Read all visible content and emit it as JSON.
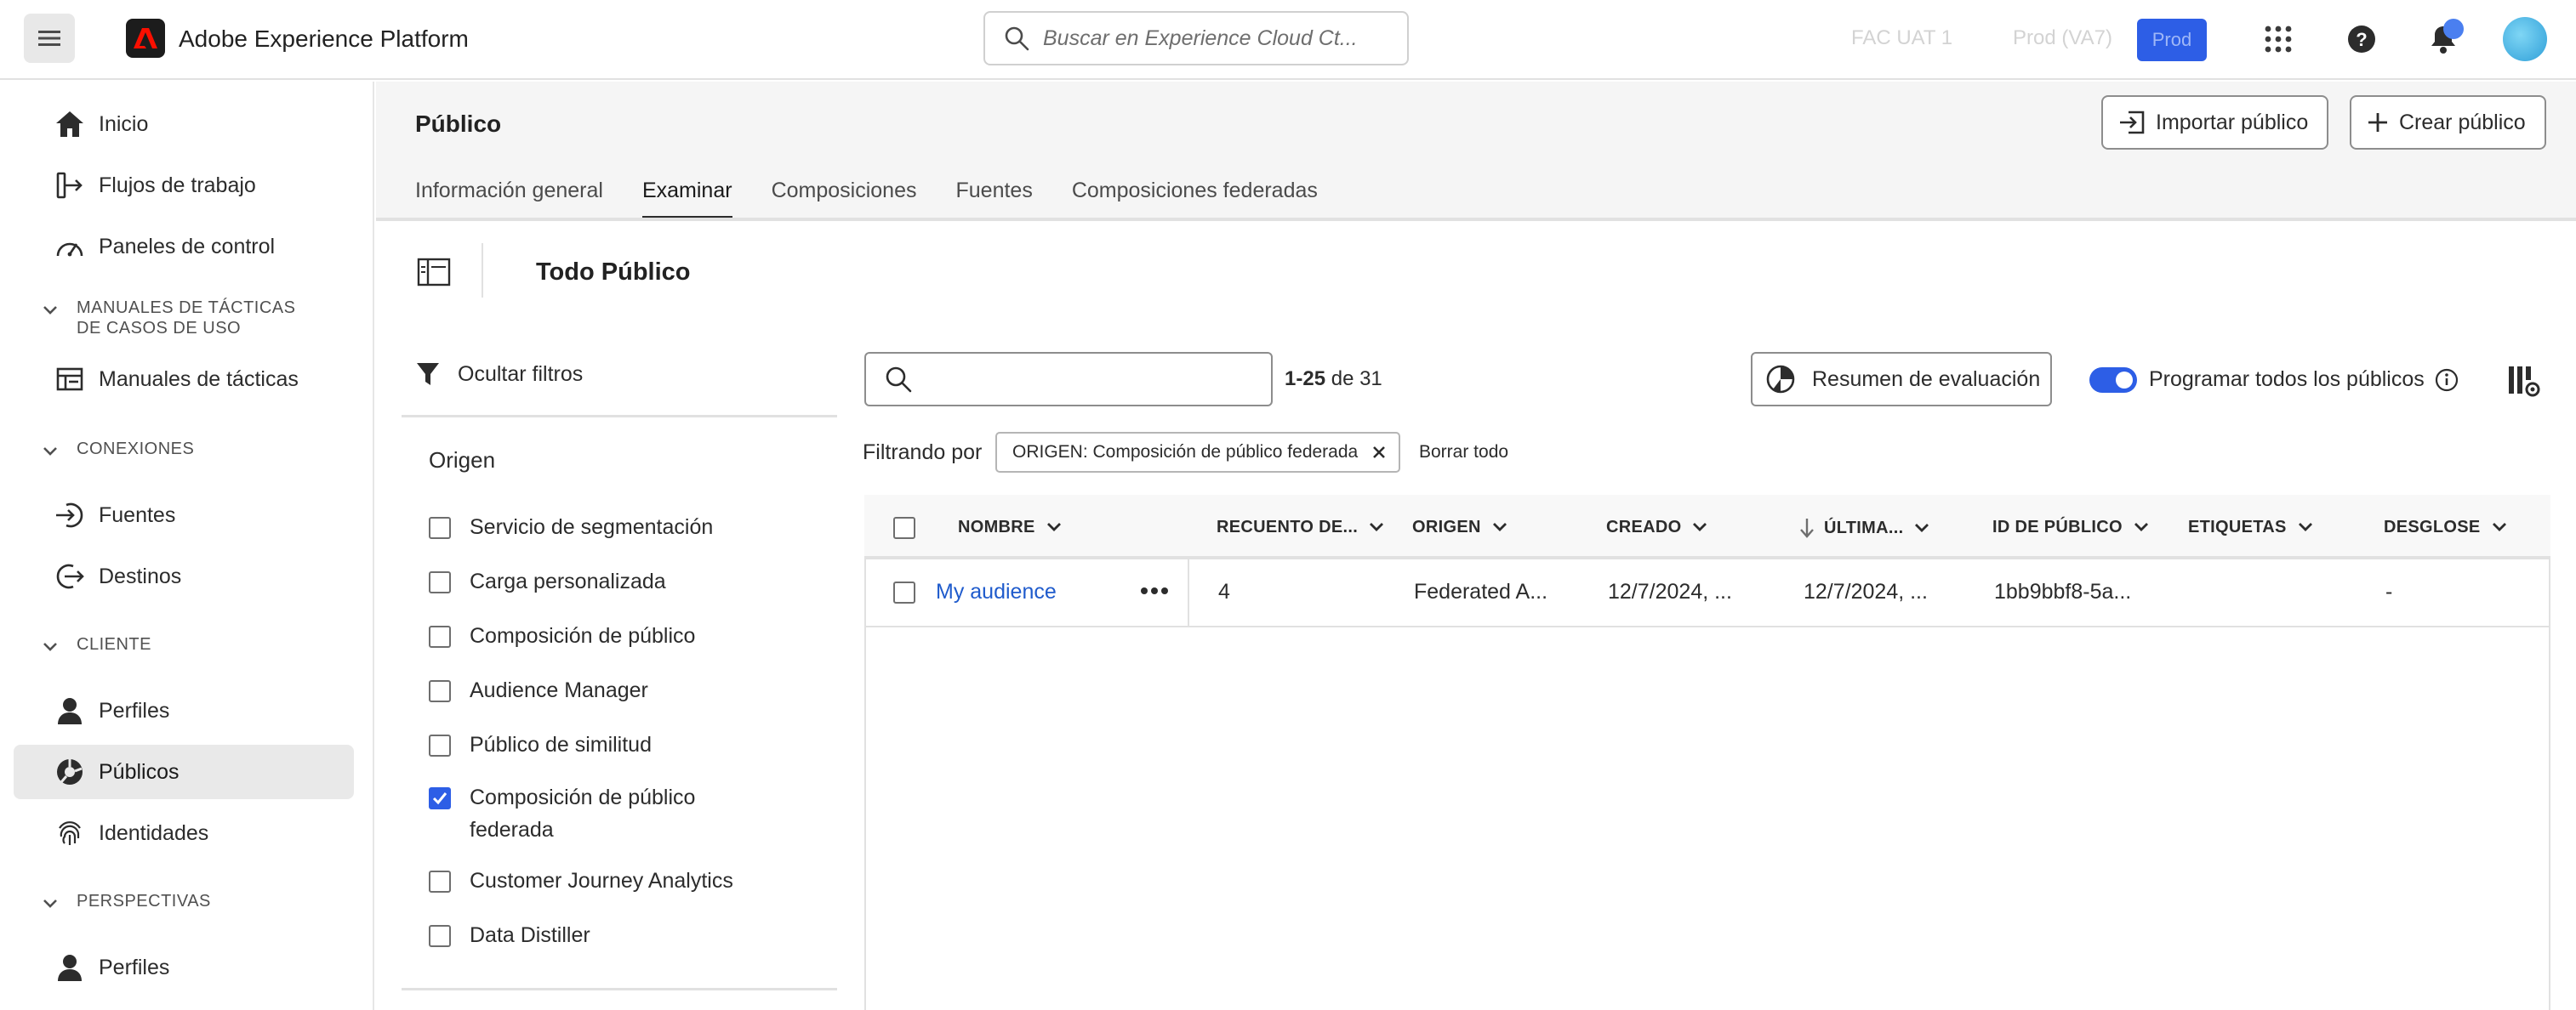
{
  "app": {
    "title": "Adobe Experience Platform"
  },
  "search": {
    "placeholder": "Buscar en Experience Cloud Ct..."
  },
  "orgs": {
    "org1": "FAC UAT 1",
    "org2": "Prod (VA7)",
    "sandbox": "Prod"
  },
  "colors": {
    "accent": "#2d5ee6",
    "link": "#1f5bcc"
  },
  "sidebar": {
    "items": [
      {
        "label": "Inicio",
        "icon": "home-icon"
      },
      {
        "label": "Flujos de trabajo",
        "icon": "workflow-icon"
      },
      {
        "label": "Paneles de control",
        "icon": "dashboard-icon"
      },
      {
        "label": "Manuales de tácticas",
        "icon": "playbook-icon"
      },
      {
        "label": "Fuentes",
        "icon": "source-icon"
      },
      {
        "label": "Destinos",
        "icon": "destination-icon"
      },
      {
        "label": "Perfiles",
        "icon": "user-icon"
      },
      {
        "label": "Públicos",
        "icon": "audience-icon"
      },
      {
        "label": "Identidades",
        "icon": "fingerprint-icon"
      },
      {
        "label": "Perfiles",
        "icon": "user-icon"
      }
    ],
    "sections": {
      "playbooks": "MANUALES DE TÁCTICAS DE CASOS DE USO",
      "connections": "CONEXIONES",
      "customer": "CLIENTE",
      "insights": "PERSPECTIVAS"
    }
  },
  "page": {
    "title": "Público",
    "import_label": "Importar público",
    "create_label": "Crear público",
    "tabs": [
      "Información general",
      "Examinar",
      "Composiciones",
      "Fuentes",
      "Composiciones federadas"
    ],
    "active_tab": "Examinar",
    "subtitle": "Todo Público"
  },
  "filters": {
    "hide_label": "Ocultar filtros",
    "origin_title": "Origen",
    "options": [
      {
        "label": "Servicio de segmentación",
        "checked": false
      },
      {
        "label": "Carga personalizada",
        "checked": false
      },
      {
        "label": "Composición de público",
        "checked": false
      },
      {
        "label": "Audience Manager",
        "checked": false
      },
      {
        "label": "Público de similitud",
        "checked": false
      },
      {
        "label": "Composición de público federada",
        "checked": true
      },
      {
        "label": "Customer Journey Analytics",
        "checked": false
      },
      {
        "label": "Data Distiller",
        "checked": false
      }
    ]
  },
  "table": {
    "range": "1-25",
    "range_of": "de 31",
    "summary_label": "Resumen de evaluación",
    "schedule_label": "Programar todos los públicos",
    "schedule_on": true,
    "filtering_label": "Filtrando por",
    "chip_label": "ORIGEN: Composición de público federada",
    "clear_all": "Borrar todo",
    "columns": [
      "NOMBRE",
      "RECUENTO DE...",
      "ORIGEN",
      "CREADO",
      "ÚLTIMA...",
      "ID DE PÚBLICO",
      "ETIQUETAS",
      "DESGLOSE"
    ],
    "rows": [
      {
        "name": "My audience",
        "count": "4",
        "origin": "Federated A...",
        "created": "12/7/2024, ...",
        "updated": "12/7/2024, ...",
        "id": "1bb9bbf8-5a...",
        "tags": "",
        "breakdown": "-"
      }
    ]
  }
}
